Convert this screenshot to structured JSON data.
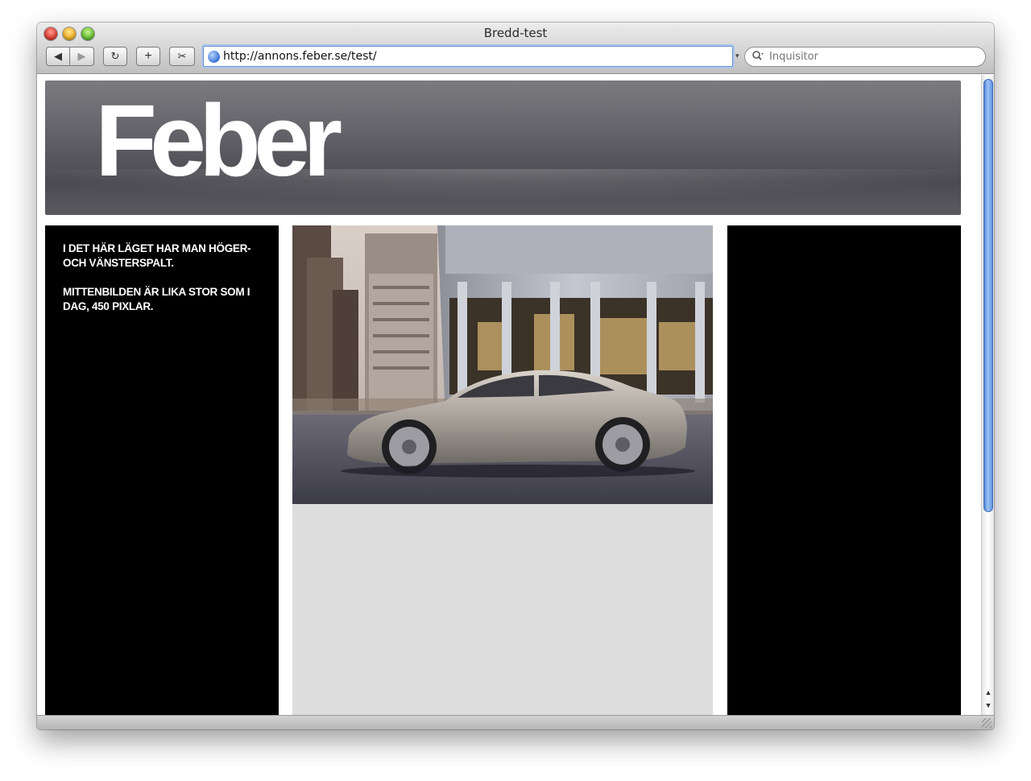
{
  "window": {
    "title": "Bredd-test"
  },
  "toolbar": {
    "back_icon": "◀",
    "forward_icon": "▶",
    "reload_icon": "↻",
    "add_bookmark_icon": "+",
    "snap_icon": "✂"
  },
  "address_bar": {
    "url": "http://annons.feber.se/test/"
  },
  "search": {
    "placeholder": "Inquisitor"
  },
  "page": {
    "logo": "Feber",
    "left_column": {
      "paragraph_1": "I DET HÄR LÄGET HAR MAN HÖGER- OCH VÄNSTERSPALT.",
      "paragraph_2": "MITTENBILDEN ÄR LIKA STOR SOM I DAG, 450 PIXLAR."
    },
    "image": {
      "icon": "car-photo"
    }
  },
  "colors": {
    "header_gray": "#5e5e63",
    "column_black": "#000000",
    "middle_gray": "#dddddd",
    "scroll_blue": "#6a9be2"
  }
}
